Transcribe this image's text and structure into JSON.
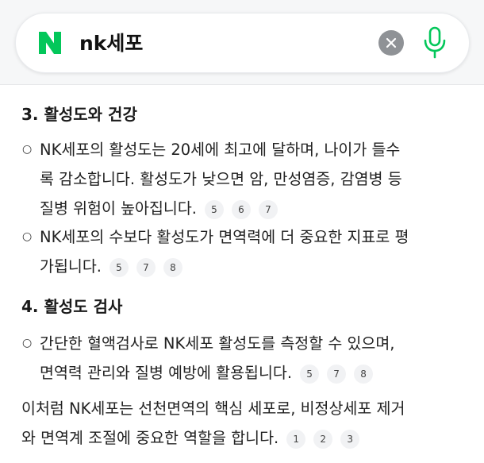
{
  "search": {
    "query": "nk세포",
    "logo_letter": "N",
    "brand_color": "#03c75a"
  },
  "sections": {
    "s3_title": "3. 활성도와 건강",
    "s3_b1_l1": "NK세포의 활성도는 20세에 최고에 달하며, 나이가 들수",
    "s3_b1_l2": "록 감소합니다. 활성도가 낮으면 암, 만성염증, 감염병 등",
    "s3_b1_l3": "질병 위험이 높아집니다.",
    "s3_b1_cites": [
      "5",
      "6",
      "7"
    ],
    "s3_b2_l1": "NK세포의 수보다 활성도가 면역력에 더 중요한 지표로 평",
    "s3_b2_l2": "가됩니다.",
    "s3_b2_cites": [
      "5",
      "7",
      "8"
    ],
    "s4_title": "4. 활성도 검사",
    "s4_b1_l1": "간단한 혈액검사로 NK세포 활성도를 측정할 수 있으며,",
    "s4_b1_l2": "면역력 관리와 질병 예방에 활용됩니다.",
    "s4_b1_cites": [
      "5",
      "7",
      "8"
    ],
    "summary_l1": "이처럼 NK세포는 선천면역의 핵심 세포로, 비정상세포 제거",
    "summary_l2": "와 면역계 조절에 중요한 역할을 합니다.",
    "summary_cites": [
      "1",
      "2",
      "3"
    ],
    "bullet_glyph": "○"
  }
}
